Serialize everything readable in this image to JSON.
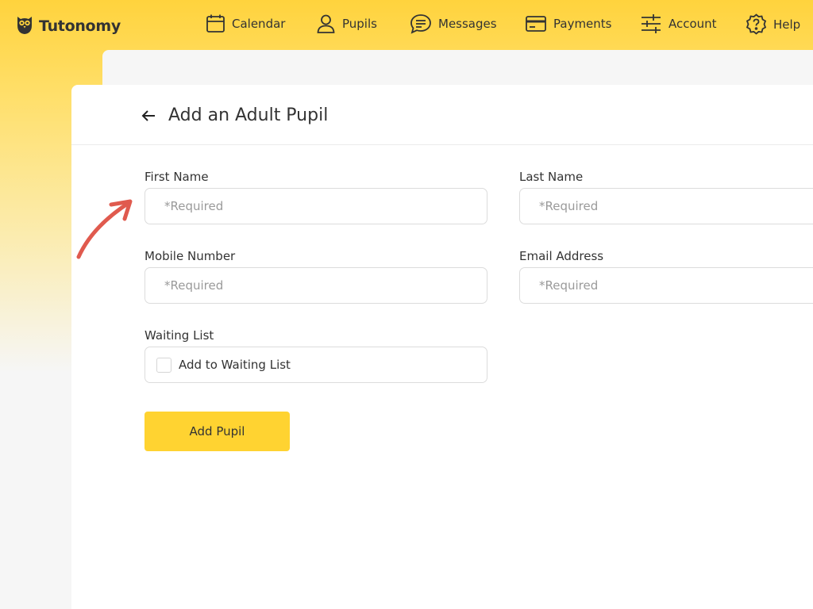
{
  "app": {
    "name": "Tutonomy"
  },
  "nav": [
    {
      "label": "Calendar",
      "icon": "calendar-icon"
    },
    {
      "label": "Pupils",
      "icon": "user-icon"
    },
    {
      "label": "Messages",
      "icon": "chat-bubble-icon"
    },
    {
      "label": "Payments",
      "icon": "credit-card-icon"
    },
    {
      "label": "Account",
      "icon": "sliders-icon"
    },
    {
      "label": "Help",
      "icon": "help-icon"
    }
  ],
  "page": {
    "title": "Add an Adult Pupil"
  },
  "form": {
    "first_name": {
      "label": "First Name",
      "placeholder": "*Required",
      "value": ""
    },
    "last_name": {
      "label": "Last Name",
      "placeholder": "*Required",
      "value": ""
    },
    "mobile": {
      "label": "Mobile Number",
      "placeholder": "*Required",
      "value": ""
    },
    "email": {
      "label": "Email Address",
      "placeholder": "*Required",
      "value": ""
    },
    "waiting_list": {
      "label": "Waiting List",
      "checkbox_label": "Add to Waiting List",
      "checked": false
    },
    "submit_label": "Add Pupil"
  },
  "colors": {
    "brand_yellow": "#ffd331",
    "annotation_red": "#e05a4e"
  }
}
